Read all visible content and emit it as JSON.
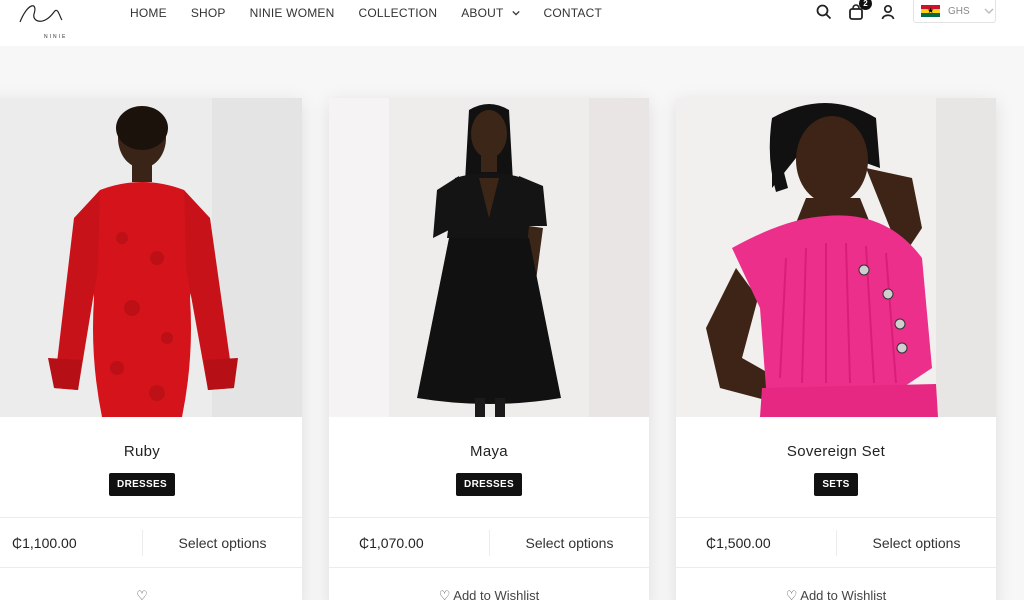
{
  "header": {
    "logo_text": "NINIE",
    "nav": [
      {
        "label": "HOME"
      },
      {
        "label": "SHOP"
      },
      {
        "label": "NINIE WOMEN"
      },
      {
        "label": "COLLECTION"
      },
      {
        "label": "ABOUT",
        "has_dropdown": true
      },
      {
        "label": "CONTACT"
      }
    ],
    "cart_count": "2",
    "currency": {
      "code": "GHS",
      "flag": "ghana-flag"
    },
    "icons": [
      "search-icon",
      "cart-icon",
      "user-icon",
      "chevron-down-icon"
    ]
  },
  "products": [
    {
      "name": "Ruby",
      "category": "DRESSES",
      "price": "₵1,100.00",
      "action": "Select options",
      "wishlist": "♡",
      "image": {
        "subject": "red lace dress",
        "dress_color": "#d4141a",
        "bg": "#efefef"
      }
    },
    {
      "name": "Maya",
      "category": "DRESSES",
      "price": "₵1,070.00",
      "action": "Select options",
      "wishlist": "♡ Add to Wishlist",
      "image": {
        "subject": "black dress",
        "dress_color": "#111111",
        "bg": "#f1eeee"
      }
    },
    {
      "name": "Sovereign Set",
      "category": "SETS",
      "price": "₵1,500.00",
      "action": "Select options",
      "wishlist": "♡ Add to Wishlist",
      "image": {
        "subject": "pink set",
        "dress_color": "#ec2f8a",
        "bg": "#f2f1f0"
      }
    }
  ],
  "colors": {
    "accent": "#111111",
    "page_bg": "#f7f7f7",
    "card_bg": "#ffffff"
  }
}
